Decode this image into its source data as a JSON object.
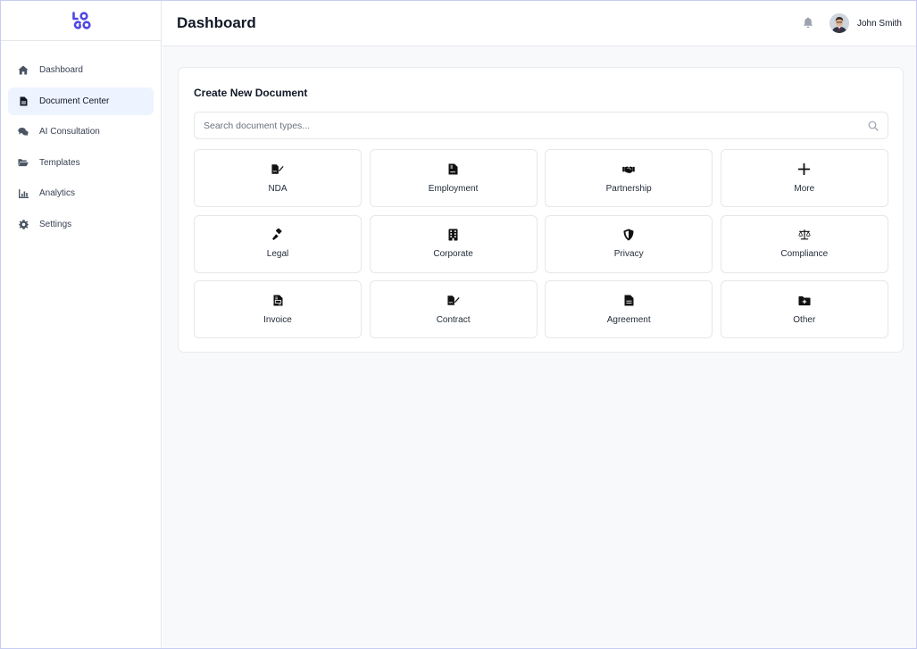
{
  "logo": {
    "text_top": "LO",
    "text_bottom": "GO",
    "color": "#4f46e5"
  },
  "sidebar": {
    "items": [
      {
        "label": "Dashboard",
        "icon": "home-icon"
      },
      {
        "label": "Document Center",
        "icon": "file-icon",
        "active": true
      },
      {
        "label": "AI Consultation",
        "icon": "comments-icon"
      },
      {
        "label": "Templates",
        "icon": "folder-open-icon"
      },
      {
        "label": "Analytics",
        "icon": "chart-icon"
      },
      {
        "label": "Settings",
        "icon": "gear-icon"
      }
    ]
  },
  "header": {
    "title": "Dashboard",
    "user_name": "John Smith",
    "notification_icon": "bell-icon"
  },
  "main": {
    "card_title": "Create New Document",
    "search_placeholder": "Search document types...",
    "tiles": [
      {
        "label": "NDA",
        "icon": "file-signature-icon"
      },
      {
        "label": "Employment",
        "icon": "file-contract-icon"
      },
      {
        "label": "Partnership",
        "icon": "handshake-icon"
      },
      {
        "label": "More",
        "icon": "plus-icon"
      },
      {
        "label": "Legal",
        "icon": "gavel-icon"
      },
      {
        "label": "Corporate",
        "icon": "building-icon"
      },
      {
        "label": "Privacy",
        "icon": "shield-icon"
      },
      {
        "label": "Compliance",
        "icon": "scale-icon"
      },
      {
        "label": "Invoice",
        "icon": "invoice-icon"
      },
      {
        "label": "Contract",
        "icon": "file-signature-icon"
      },
      {
        "label": "Agreement",
        "icon": "file-icon"
      },
      {
        "label": "Other",
        "icon": "folder-plus-icon"
      }
    ]
  }
}
